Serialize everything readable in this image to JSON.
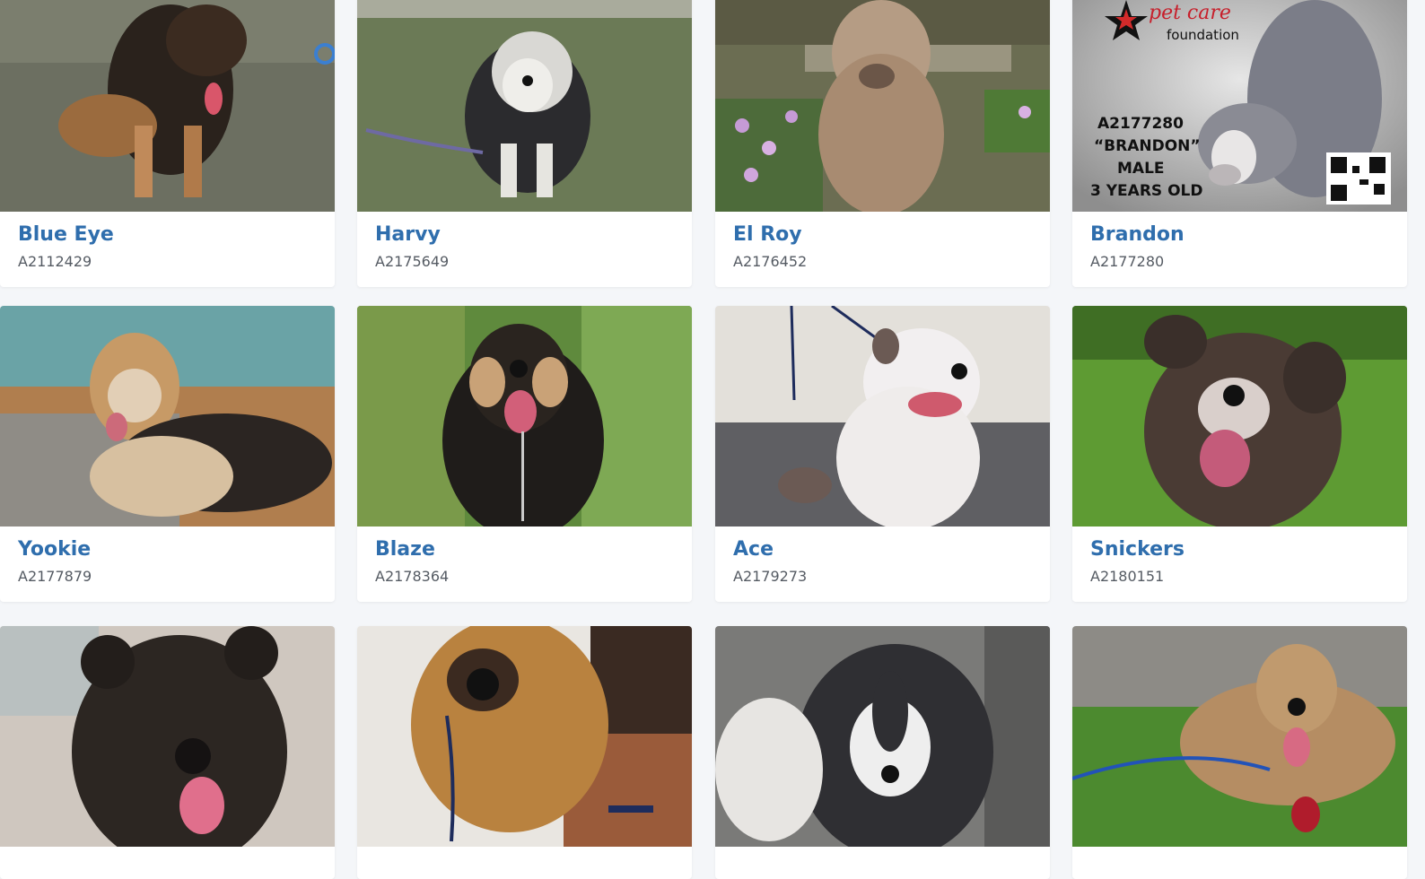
{
  "cards": [
    {
      "name": "Blue Eye",
      "id": "A2112429"
    },
    {
      "name": "Harvy",
      "id": "A2175649"
    },
    {
      "name": "El Roy",
      "id": "A2176452"
    },
    {
      "name": "Brandon",
      "id": "A2177280"
    },
    {
      "name": "Yookie",
      "id": "A2177879"
    },
    {
      "name": "Blaze",
      "id": "A2178364"
    },
    {
      "name": "Ace",
      "id": "A2179273"
    },
    {
      "name": "Snickers",
      "id": "A2180151"
    },
    {
      "name": "",
      "id": ""
    },
    {
      "name": "",
      "id": ""
    },
    {
      "name": "",
      "id": ""
    },
    {
      "name": "",
      "id": ""
    }
  ],
  "poster": {
    "brand_top": "pet care",
    "brand_bottom": "foundation",
    "line1": "A2177280",
    "line2": "“BRANDON”",
    "line3": "MALE",
    "line4": "3 YEARS OLD"
  },
  "colors": {
    "name_link": "#2f6ead",
    "id_text": "#555b63",
    "page_bg": "#f4f6f9"
  }
}
